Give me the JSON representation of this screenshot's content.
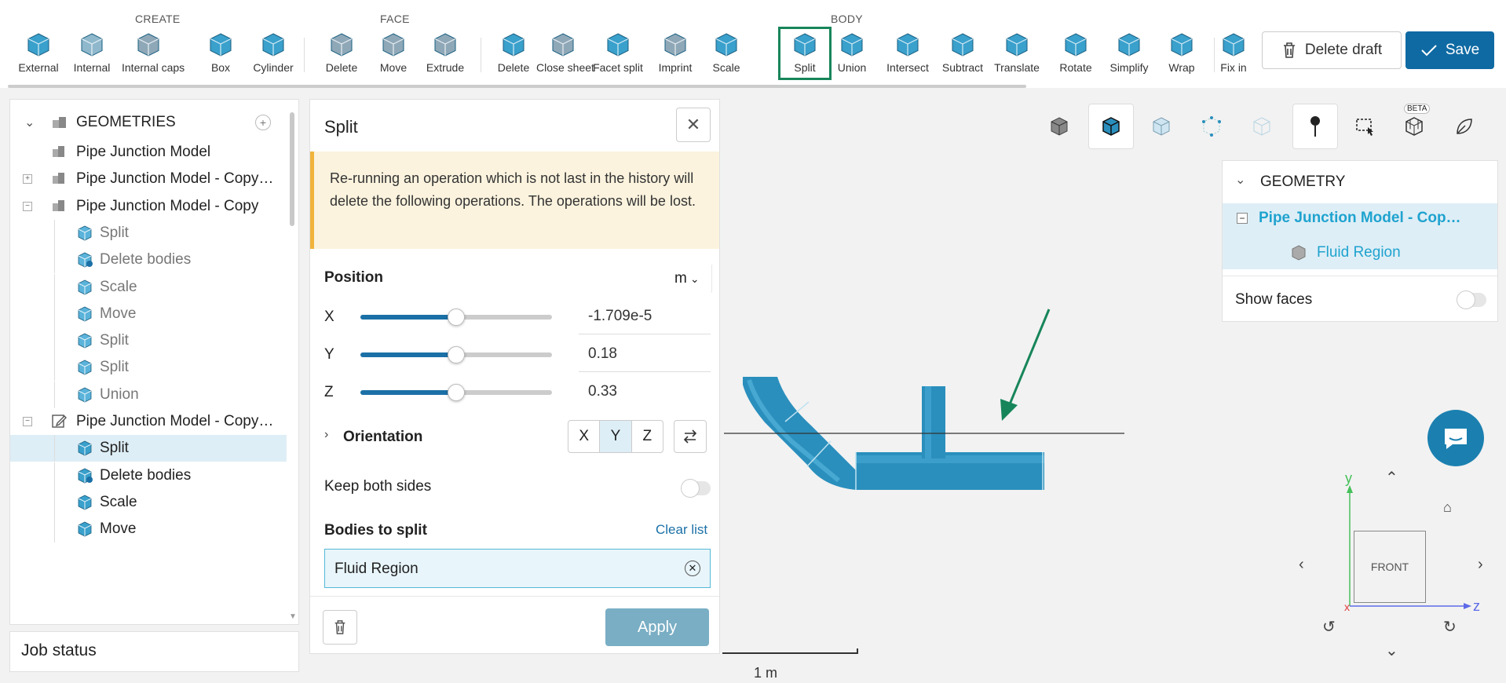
{
  "toolbar": {
    "groups": {
      "create": "CREATE",
      "face": "FACE",
      "body": "BODY"
    },
    "buttons": [
      {
        "label": "External",
        "icon": "external-icon"
      },
      {
        "label": "Internal",
        "icon": "internal-icon"
      },
      {
        "label": "Internal caps",
        "icon": "internal-caps-icon"
      },
      {
        "label": "Box",
        "icon": "box-icon"
      },
      {
        "label": "Cylinder",
        "icon": "cylinder-icon"
      },
      {
        "label": "Delete",
        "icon": "face-delete-icon"
      },
      {
        "label": "Move",
        "icon": "face-move-icon"
      },
      {
        "label": "Extrude",
        "icon": "extrude-icon"
      },
      {
        "label": "Delete",
        "icon": "body-delete-icon"
      },
      {
        "label": "Close sheet",
        "icon": "close-sheet-icon"
      },
      {
        "label": "Facet split",
        "icon": "facet-split-icon"
      },
      {
        "label": "Imprint",
        "icon": "imprint-icon"
      },
      {
        "label": "Scale",
        "icon": "scale-icon"
      },
      {
        "label": "Split",
        "icon": "split-icon"
      },
      {
        "label": "Union",
        "icon": "union-icon"
      },
      {
        "label": "Intersect",
        "icon": "intersect-icon"
      },
      {
        "label": "Subtract",
        "icon": "subtract-icon"
      },
      {
        "label": "Translate",
        "icon": "translate-icon"
      },
      {
        "label": "Rotate",
        "icon": "rotate-icon"
      },
      {
        "label": "Simplify",
        "icon": "simplify-icon"
      },
      {
        "label": "Wrap",
        "icon": "wrap-icon"
      },
      {
        "label": "Fix in",
        "icon": "fix-icon"
      }
    ],
    "delete_draft": "Delete draft",
    "save": "Save"
  },
  "tree": {
    "header": "GEOMETRIES",
    "items": [
      {
        "label": "Pipe Junction Model"
      },
      {
        "label": "Pipe Junction Model - Copy…"
      },
      {
        "label": "Pipe Junction Model - Copy"
      },
      {
        "label": "Split"
      },
      {
        "label": "Delete bodies"
      },
      {
        "label": "Scale"
      },
      {
        "label": "Move"
      },
      {
        "label": "Split"
      },
      {
        "label": "Split"
      },
      {
        "label": "Union"
      },
      {
        "label": "Pipe Junction Model - Copy…"
      },
      {
        "label": "Split"
      },
      {
        "label": "Delete bodies"
      },
      {
        "label": "Scale"
      },
      {
        "label": "Move"
      }
    ]
  },
  "job_status": "Job status",
  "split_panel": {
    "title": "Split",
    "warning": "Re-running an operation which is not last in the history will delete the following operations. The operations will be lost.",
    "position_label": "Position",
    "unit": "m",
    "x_label": "X",
    "x_value": "-1.709e-5",
    "x_slider": 0.5,
    "y_label": "Y",
    "y_value": "0.18",
    "y_slider": 0.5,
    "z_label": "Z",
    "z_value": "0.33",
    "z_slider": 0.5,
    "orientation_label": "Orientation",
    "orientation_options": [
      "X",
      "Y",
      "Z"
    ],
    "orientation_selected": "Y",
    "keep_both_sides": "Keep both sides",
    "bodies_label": "Bodies to split",
    "clear_list": "Clear list",
    "body": "Fluid Region",
    "apply": "Apply"
  },
  "viewport": {
    "scale_label": "1 m",
    "beta": "BETA",
    "cube_face": "FRONT",
    "axis_y": "y",
    "axis_z": "z",
    "axis_x": "x"
  },
  "geometry_panel": {
    "header": "GEOMETRY",
    "model": "Pipe Junction Model - Cop…",
    "body": "Fluid Region",
    "show_faces": "Show faces"
  },
  "colors": {
    "accent": "#0f6aa3",
    "highlight": "#17855a",
    "selected_text": "#1fa3cf"
  }
}
